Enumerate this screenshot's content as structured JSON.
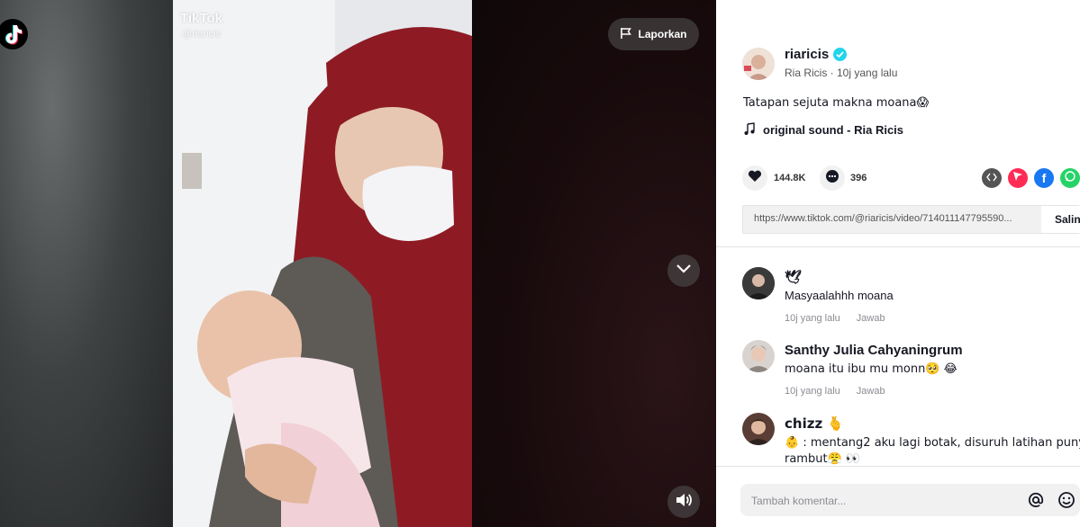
{
  "overlay": {
    "watermark_brand": "TikTok",
    "watermark_handle": "@riaricis",
    "report_label": "Laporkan"
  },
  "author": {
    "username": "riaricis",
    "display_name": "Ria Ricis",
    "time_ago": "10j yang lalu",
    "subline": "Ria Ricis · 10j yang lalu"
  },
  "video": {
    "caption": "Tatapan sejuta makna moana😱",
    "music": "original sound - Ria Ricis",
    "likes": "144.8K",
    "comments": "396",
    "url": "https://www.tiktok.com/@riaricis/video/714011147795590...",
    "copy_label": "Salin"
  },
  "comments": [
    {
      "name": "🕊",
      "text": "Masyaalahhh moana",
      "time": "10j yang lalu",
      "reply": "Jawab"
    },
    {
      "name": "Santhy Julia Cahyaningrum",
      "text": "moana itu ibu mu monn🥺 😂",
      "time": "10j yang lalu",
      "reply": "Jawab"
    },
    {
      "name": "chizz 🫰",
      "text": "👶 : mentang2 aku lagi botak, disuruh latihan punya",
      "text2": "rambut😤 👀"
    }
  ],
  "comment_input": {
    "placeholder": "Tambah komentar..."
  },
  "colors": {
    "accent_red": "#fe2c55",
    "verified_blue": "#20d5ec",
    "facebook_blue": "#1877f2",
    "whatsapp_green": "#25d366"
  }
}
